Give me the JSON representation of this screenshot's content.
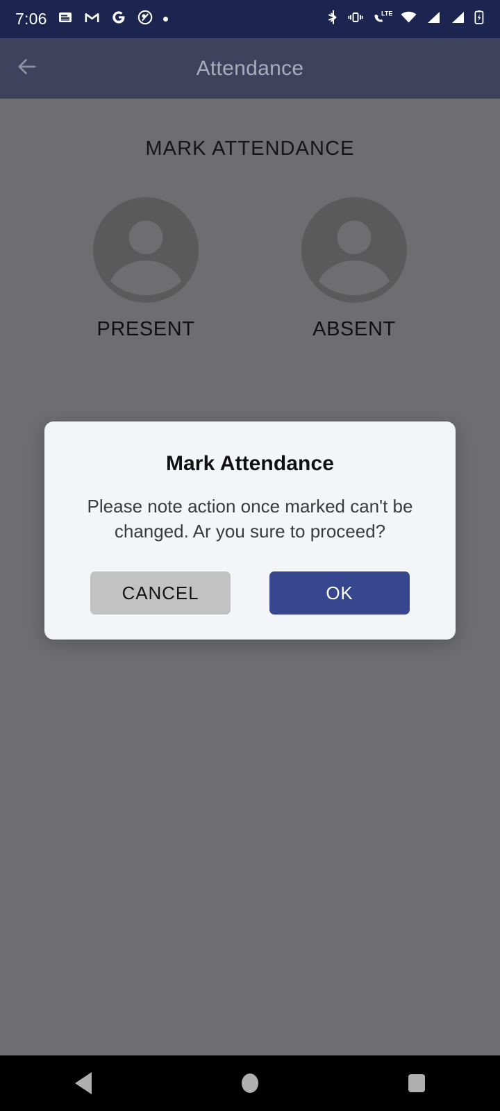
{
  "status_bar": {
    "time": "7:06",
    "left_icons": [
      "news-icon",
      "gmail-icon",
      "google-icon",
      "adobe-scan-icon",
      "dot-icon"
    ],
    "right_icons": [
      "bluetooth-icon",
      "vibrate-icon",
      "lte-call-icon",
      "wifi-icon",
      "signal-icon-1",
      "signal-icon-2",
      "battery-charging-icon"
    ],
    "background": "#1c2450"
  },
  "app_bar": {
    "title": "Attendance",
    "back_icon": "arrow-left-icon",
    "background": "#1c2450",
    "title_color": "#a8adba"
  },
  "main": {
    "heading": "MARK ATTENDANCE",
    "options": [
      {
        "label": "PRESENT",
        "icon": "person-avatar-icon"
      },
      {
        "label": "ABSENT",
        "icon": "person-avatar-icon"
      }
    ],
    "scrim_color": "#6e6e70"
  },
  "dialog": {
    "title": "Mark Attendance",
    "message": "Please note action once marked can't be changed. Ar you sure to proceed?",
    "cancel_label": "CANCEL",
    "ok_label": "OK",
    "background": "#f4f5f8",
    "cancel_color": "#c2c2c2",
    "ok_color": "#36478f"
  },
  "nav_bar": {
    "back_icon": "triangle-back-icon",
    "home_icon": "circle-home-icon",
    "recents_icon": "square-recents-icon",
    "background": "#000000"
  }
}
